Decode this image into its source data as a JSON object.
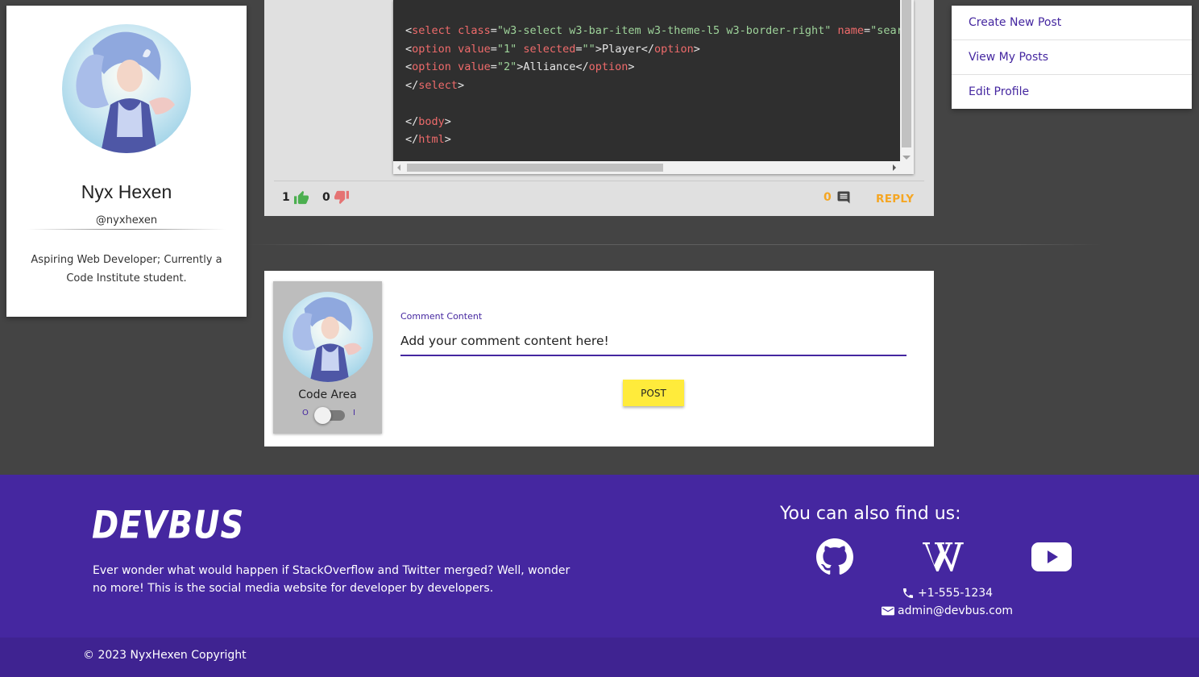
{
  "profile": {
    "name": "Nyx Hexen",
    "handle": "@nyxhexen",
    "bio": "Aspiring Web Developer; Currently a Code Institute student."
  },
  "post": {
    "code_lines": [
      [
        {
          "c": "t-p",
          "t": "<"
        },
        {
          "c": "t-tag",
          "t": "select"
        },
        {
          "c": "t-p",
          "t": " "
        },
        {
          "c": "t-attr",
          "t": "class"
        },
        {
          "c": "t-p",
          "t": "="
        },
        {
          "c": "t-str",
          "t": "\"w3-select w3-bar-item w3-theme-l5 w3-border-right\""
        },
        {
          "c": "t-p",
          "t": " "
        },
        {
          "c": "t-attr",
          "t": "name"
        },
        {
          "c": "t-p",
          "t": "="
        },
        {
          "c": "t-str",
          "t": "\"search_type\">"
        }
      ],
      [
        {
          "c": "t-p",
          "t": "<"
        },
        {
          "c": "t-tag",
          "t": "option"
        },
        {
          "c": "t-p",
          "t": " "
        },
        {
          "c": "t-attr",
          "t": "value"
        },
        {
          "c": "t-p",
          "t": "="
        },
        {
          "c": "t-str",
          "t": "\"1\""
        },
        {
          "c": "t-p",
          "t": " "
        },
        {
          "c": "t-attr",
          "t": "selected"
        },
        {
          "c": "t-p",
          "t": "="
        },
        {
          "c": "t-str",
          "t": "\"\""
        },
        {
          "c": "t-p",
          "t": ">Player</"
        },
        {
          "c": "t-tag",
          "t": "option"
        },
        {
          "c": "t-p",
          "t": ">"
        }
      ],
      [
        {
          "c": "t-p",
          "t": "<"
        },
        {
          "c": "t-tag",
          "t": "option"
        },
        {
          "c": "t-p",
          "t": " "
        },
        {
          "c": "t-attr",
          "t": "value"
        },
        {
          "c": "t-p",
          "t": "="
        },
        {
          "c": "t-str",
          "t": "\"2\""
        },
        {
          "c": "t-p",
          "t": ">Alliance</"
        },
        {
          "c": "t-tag",
          "t": "option"
        },
        {
          "c": "t-p",
          "t": ">"
        }
      ],
      [
        {
          "c": "t-p",
          "t": "</"
        },
        {
          "c": "t-tag",
          "t": "select"
        },
        {
          "c": "t-p",
          "t": ">"
        }
      ],
      [
        {
          "c": "t-p",
          "t": ""
        }
      ],
      [
        {
          "c": "t-p",
          "t": "</"
        },
        {
          "c": "t-tag",
          "t": "body"
        },
        {
          "c": "t-p",
          "t": ">"
        }
      ],
      [
        {
          "c": "t-p",
          "t": "</"
        },
        {
          "c": "t-tag",
          "t": "html"
        },
        {
          "c": "t-p",
          "t": ">"
        }
      ]
    ],
    "likes": "1",
    "dislikes": "0",
    "reply_count": "0",
    "reply_label": "REPLY"
  },
  "menu": {
    "items": [
      "Create New Post",
      "View My Posts",
      "Edit Profile"
    ]
  },
  "comment_form": {
    "toggle_label": "Code Area",
    "toggle_off": "O",
    "toggle_on": "I",
    "field_label": "Comment Content",
    "field_value": "Add your comment content here!",
    "post_label": "POST"
  },
  "footer": {
    "logo": "DEVBUS",
    "text": "Ever wonder what would happen if StackOverflow and Twitter merged? Well, wonder no more! This is the social media website for developer by developers.",
    "find_us": "You can also find us:",
    "phone": "+1-555-1234",
    "email": "admin@devbus.com",
    "copyright": "© 2023 NyxHexen Copyright",
    "social": [
      "github-icon",
      "wikipedia-icon",
      "youtube-icon"
    ]
  },
  "colors": {
    "primary": "#4527a0",
    "accent": "#f5a623",
    "post_button": "#ffeb3b",
    "like": "#4caf50",
    "dislike": "#e57373"
  }
}
